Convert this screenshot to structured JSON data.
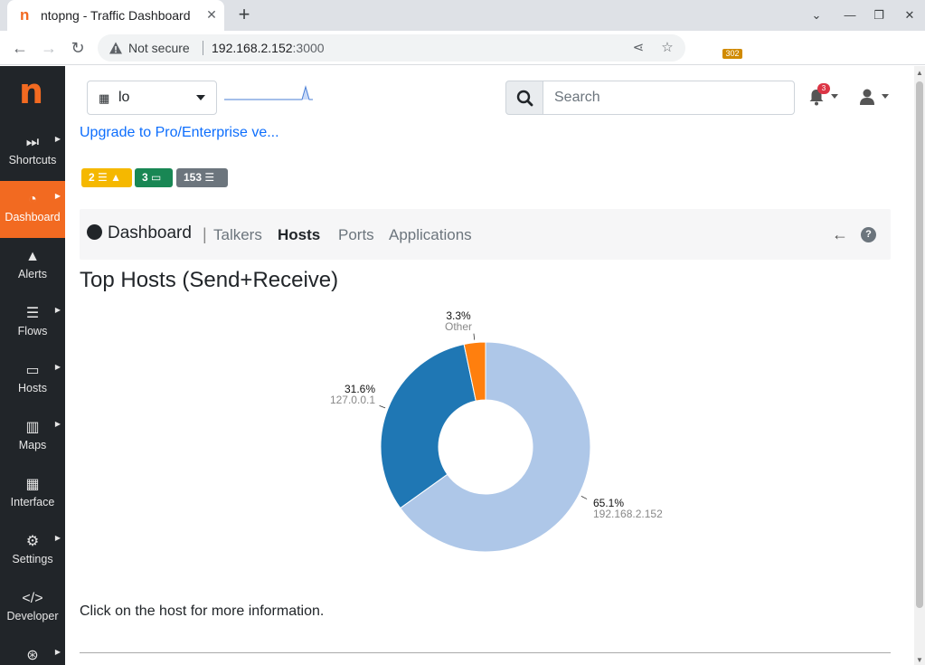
{
  "browser": {
    "tab_title": "ntopng - Traffic Dashboard",
    "tab_favicon": "n",
    "close_tab": "✕",
    "new_tab": "+",
    "security_label": "Not secure",
    "url_host": "192.168.2.152",
    "url_port": ":3000",
    "extension_badge": "302"
  },
  "sidebar": {
    "logo": "n",
    "items": [
      {
        "label": "Shortcuts",
        "icon": "fast-forward-icon",
        "glyph": "⏭",
        "caret": true
      },
      {
        "label": "Dashboard",
        "icon": "dashboard-gauge-icon",
        "glyph": "◔",
        "caret": true,
        "active": true
      },
      {
        "label": "Alerts",
        "icon": "warning-icon",
        "glyph": "▲",
        "caret": false
      },
      {
        "label": "Flows",
        "icon": "list-icon",
        "glyph": "☰",
        "caret": true
      },
      {
        "label": "Hosts",
        "icon": "laptop-icon",
        "glyph": "▭",
        "caret": true
      },
      {
        "label": "Maps",
        "icon": "map-icon",
        "glyph": "▥",
        "caret": true
      },
      {
        "label": "Interface",
        "icon": "ethernet-icon",
        "glyph": "▦",
        "caret": false
      },
      {
        "label": "Settings",
        "icon": "gear-icon",
        "glyph": "⚙",
        "caret": true
      },
      {
        "label": "Developer",
        "icon": "code-icon",
        "glyph": "</>",
        "caret": false
      },
      {
        "label": "Help",
        "icon": "lifebuoy-icon",
        "glyph": "⊛",
        "caret": true
      }
    ]
  },
  "topbar": {
    "interface": "lo",
    "search_placeholder": "Search",
    "notifications_count": "3"
  },
  "upgrade_link": "Upgrade to Pro/Enterprise ve...",
  "badges": {
    "alerts": "2",
    "hosts": "3",
    "flows": "153"
  },
  "nav": {
    "brand": "Dashboard",
    "separator": "|",
    "links": [
      "Talkers",
      "Hosts",
      "Ports",
      "Applications"
    ],
    "active": "Hosts"
  },
  "page_title": "Top Hosts (Send+Receive)",
  "footnote": "Click on the host for more information.",
  "colors": {
    "brand": "#f26a21",
    "sidebar_bg": "#212529",
    "link": "#0d6efd"
  },
  "chart_data": {
    "type": "pie",
    "donut": true,
    "slices": [
      {
        "label": "192.168.2.152",
        "value": 65.1,
        "value_label": "65.1%",
        "color": "#aec7e8"
      },
      {
        "label": "127.0.0.1",
        "value": 31.6,
        "value_label": "31.6%",
        "color": "#1f77b4"
      },
      {
        "label": "Other",
        "value": 3.3,
        "value_label": "3.3%",
        "color": "#ff7f0e"
      }
    ]
  }
}
